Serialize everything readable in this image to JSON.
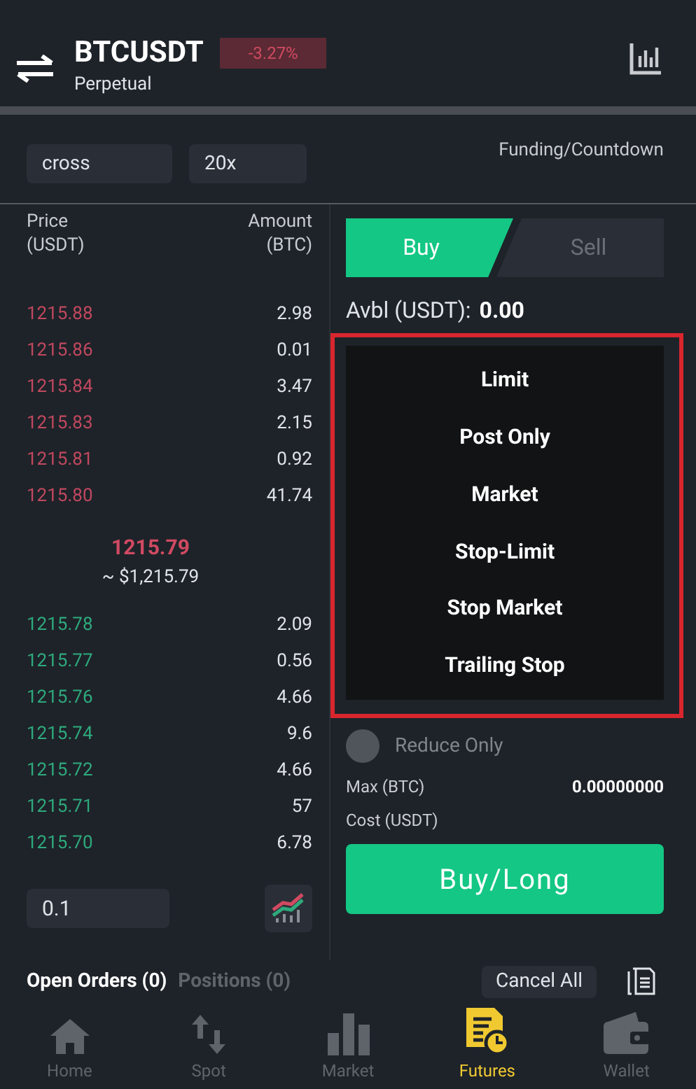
{
  "header": {
    "symbol": "BTCUSDT",
    "change": "-3.27%",
    "subtitle": "Perpetual"
  },
  "controls": {
    "margin_mode": "cross",
    "leverage": "20x",
    "funding_label": "Funding/Countdown"
  },
  "orderbook": {
    "price_header": [
      "Price",
      "(USDT)"
    ],
    "amount_header": [
      "Amount",
      "(BTC)"
    ],
    "asks": [
      {
        "price": "1215.88",
        "amount": "2.98"
      },
      {
        "price": "1215.86",
        "amount": "0.01"
      },
      {
        "price": "1215.84",
        "amount": "3.47"
      },
      {
        "price": "1215.83",
        "amount": "2.15"
      },
      {
        "price": "1215.81",
        "amount": "0.92"
      },
      {
        "price": "1215.80",
        "amount": "41.74"
      }
    ],
    "last_price": "1215.79",
    "last_price_usd": "~ $1,215.79",
    "bids": [
      {
        "price": "1215.78",
        "amount": "2.09"
      },
      {
        "price": "1215.77",
        "amount": "0.56"
      },
      {
        "price": "1215.76",
        "amount": "4.66"
      },
      {
        "price": "1215.74",
        "amount": "9.6"
      },
      {
        "price": "1215.72",
        "amount": "4.66"
      },
      {
        "price": "1215.71",
        "amount": "57"
      },
      {
        "price": "1215.70",
        "amount": "6.78"
      }
    ],
    "depth_value": "0.1"
  },
  "order_form": {
    "sides": [
      {
        "label": "Buy",
        "selected": true
      },
      {
        "label": "Sell",
        "selected": false
      }
    ],
    "available_label": "Avbl (USDT):",
    "available_value": "0.00",
    "reduce_only": {
      "label": "Reduce Only",
      "checked": false
    },
    "max_label": "Max (BTC)",
    "max_value": "0.00000000",
    "cost_label": "Cost (USDT)",
    "submit": "Buy/Long"
  },
  "order_type_menu": {
    "items": [
      "Limit",
      "Post Only",
      "Market",
      "Stop-Limit",
      "Stop Market",
      "Trailing Stop"
    ]
  },
  "orders_tabs": [
    {
      "label": "Open Orders (0)",
      "selected": true
    },
    {
      "label": "Positions (0)",
      "selected": false
    }
  ],
  "cancel_all": "Cancel All",
  "nav": [
    {
      "label": "Home",
      "selected": false
    },
    {
      "label": "Spot",
      "selected": false
    },
    {
      "label": "Market",
      "selected": false
    },
    {
      "label": "Futures",
      "selected": true
    },
    {
      "label": "Wallet",
      "selected": false
    }
  ]
}
